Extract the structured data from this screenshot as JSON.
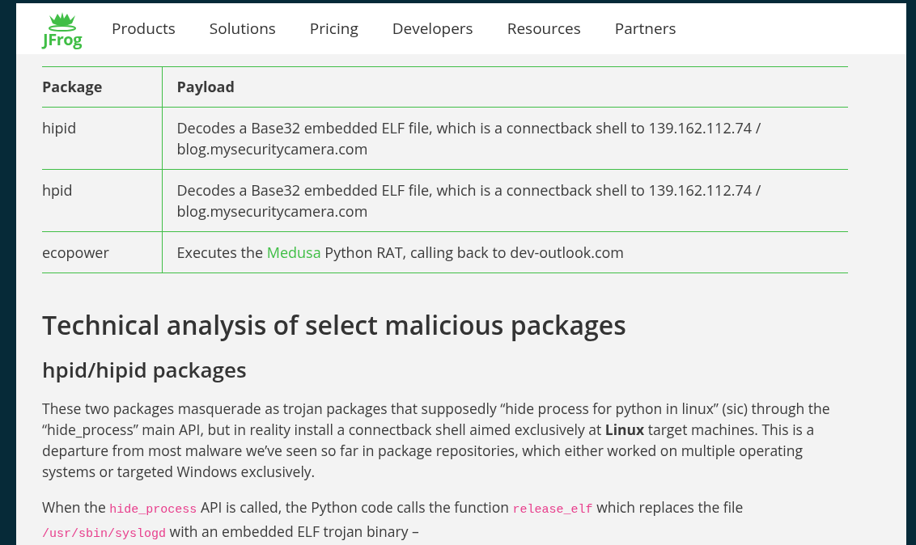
{
  "header": {
    "logo_text": "JFrog",
    "nav": [
      "Products",
      "Solutions",
      "Pricing",
      "Developers",
      "Resources",
      "Partners"
    ]
  },
  "table": {
    "columns": [
      "Package",
      "Payload"
    ],
    "rows": [
      {
        "cells": [
          [
            {
              "kind": "text",
              "text": "hipid"
            }
          ],
          [
            {
              "kind": "text",
              "text": "Decodes a Base32 embedded ELF file, which is a connectback shell to 139.162.112.74 / blog.mysecuritycamera.com"
            }
          ]
        ]
      },
      {
        "cells": [
          [
            {
              "kind": "text",
              "text": "hpid"
            }
          ],
          [
            {
              "kind": "text",
              "text": "Decodes a Base32 embedded ELF file, which is a connectback shell to 139.162.112.74 / blog.mysecuritycamera.com"
            }
          ]
        ]
      },
      {
        "cells": [
          [
            {
              "kind": "text",
              "text": "ecopower"
            }
          ],
          [
            {
              "kind": "text",
              "text": "Executes the "
            },
            {
              "kind": "link",
              "text": "Medusa"
            },
            {
              "kind": "text",
              "text": " Python RAT, calling back to dev-outlook.com"
            }
          ]
        ]
      }
    ]
  },
  "heading": "Technical analysis of select malicious packages",
  "subheading": "hpid/hipid packages",
  "paragraphs": [
    [
      {
        "kind": "text",
        "text": "These two packages masquerade as trojan packages that supposedly “hide process for python in linux” (sic) through the “hide_process” main API, but in reality install a connectback shell aimed exclusively at **Linux** target machines. This is a departure from most malware we’ve seen so far in package repositories, which either worked on multiple operating systems or targeted Windows exclusively."
      }
    ],
    [
      {
        "kind": "text",
        "text": "When the "
      },
      {
        "kind": "code",
        "text": "hide_process"
      },
      {
        "kind": "text",
        "text": " API is called, the Python code calls the function "
      },
      {
        "kind": "code",
        "text": "release_elf"
      },
      {
        "kind": "text",
        "text": " which replaces the file "
      },
      {
        "kind": "code",
        "text": "/usr/sbin/syslogd"
      },
      {
        "kind": "text",
        "text": " with an embedded ELF trojan binary –"
      }
    ]
  ]
}
